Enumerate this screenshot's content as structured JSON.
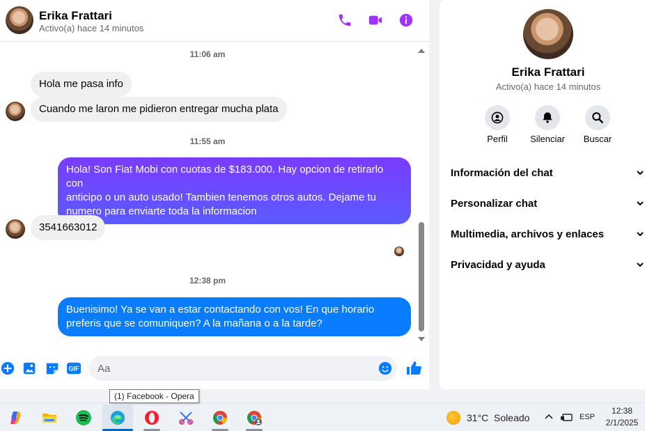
{
  "colors": {
    "accent": "#a033ff",
    "messenger_blue": "#0a7cff",
    "bubble_gradient_start": "#7a3cff",
    "bubble_gradient_end": "#5b5bff"
  },
  "header": {
    "name": "Erika Frattari",
    "status": "Activo(a) hace 14 minutos",
    "icons": [
      "phone-icon",
      "video-icon",
      "info-icon"
    ]
  },
  "messages": {
    "time1": "11:06 am",
    "msg1": "Hola me pasa info",
    "msg2": "Cuando me laron me pidieron entregar mucha plata",
    "time2": "11:55 am",
    "msg3_line1": "Hola! Son Fiat Mobi con cuotas de $183.000. Hay opcion de retirarlo con",
    "msg3_line2": "anticipo o un auto usado! Tambien tenemos otros autos. Dejame tu",
    "msg3_line3": "numero para enviarte toda la informacion",
    "msg4": "3541663012",
    "time3": "12:38 pm",
    "msg5_line1": "Buenisimo! Ya se van a estar contactando con vos! En que horario",
    "msg5_line2": "preferis que se comuniquen? A la mañana o a la tarde?"
  },
  "composer": {
    "placeholder": "Aa",
    "gif_label": "GIF"
  },
  "info_panel": {
    "name": "Erika Frattari",
    "status": "Activo(a) hace 14 minutos",
    "actions": [
      {
        "label": "Perfil",
        "icon": "profile-icon"
      },
      {
        "label": "Silenciar",
        "icon": "bell-icon"
      },
      {
        "label": "Buscar",
        "icon": "search-icon"
      }
    ],
    "sections": [
      "Información del chat",
      "Personalizar chat",
      "Multimedia, archivos y enlaces",
      "Privacidad y ayuda"
    ]
  },
  "tooltip": "(1) Facebook - Opera",
  "taskbar": {
    "apps": [
      "copilot-icon",
      "file-explorer-icon",
      "spotify-icon",
      "edge-icon",
      "opera-icon",
      "snipping-icon",
      "chrome-icon",
      "chrome-profile-icon"
    ],
    "weather": "31°C  Soleado",
    "language": "ESP",
    "time": "12:38",
    "date": "2/1/2025"
  }
}
